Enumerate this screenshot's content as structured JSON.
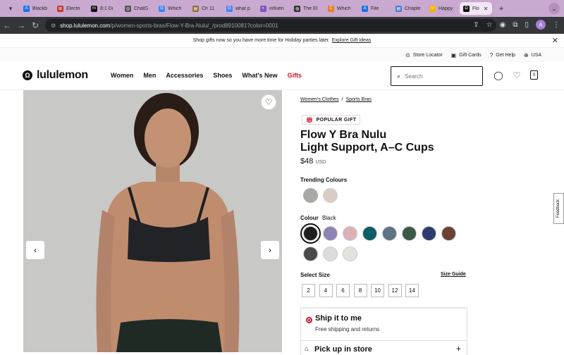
{
  "tabs": [
    {
      "label": "Blackb",
      "color": "#1a73e8",
      "glyph": "A"
    },
    {
      "label": "Electri",
      "color": "#c0392b",
      "glyph": "⊞"
    },
    {
      "label": "8:1 Di",
      "color": "#111111",
      "glyph": "m"
    },
    {
      "label": "ChatG",
      "color": "#555555",
      "glyph": "◎"
    },
    {
      "label": "Which",
      "color": "#4285f4",
      "glyph": "G"
    },
    {
      "label": "Ch 11",
      "color": "#8d6e3a",
      "glyph": "▤"
    },
    {
      "label": "what p",
      "color": "#4285f4",
      "glyph": "G"
    },
    {
      "label": "influen",
      "color": "#7e57c2",
      "glyph": "◐"
    },
    {
      "label": "The El",
      "color": "#333333",
      "glyph": "◍"
    },
    {
      "label": "Which",
      "color": "#e67e22",
      "glyph": "C"
    },
    {
      "label": "File",
      "color": "#1a73e8",
      "glyph": "A"
    },
    {
      "label": "Chapte",
      "color": "#4a7bd0",
      "glyph": "▤"
    },
    {
      "label": "Happy",
      "color": "#f5b400",
      "glyph": "☺"
    },
    {
      "label": "Flo",
      "color": "#111111",
      "glyph": "Ω"
    }
  ],
  "browser": {
    "url_host": "shop.lululemon.com",
    "url_path": "/p/women-sports-bras/Flow-Y-Bra-Nulu/_/prod8910081?color=0001",
    "profile_initial": "A"
  },
  "promo": {
    "text": "Shop gifts now so you have more time for Holiday parties later.",
    "link": "Explore Gift Ideas"
  },
  "utility": {
    "store_locator": "Store Locator",
    "gift_cards": "Gift Cards",
    "get_help": "Get Help",
    "region": "USA"
  },
  "header": {
    "logo_text": "lululemon",
    "menu": [
      "Women",
      "Men",
      "Accessories",
      "Shoes",
      "What's New",
      "Gifts"
    ],
    "search_placeholder": "Search",
    "bag_count": "0"
  },
  "product": {
    "breadcrumbs": [
      "Women's Clothes",
      "Sports Bras"
    ],
    "breadcrumb_sep": "/",
    "badge": "POPULAR GIFT",
    "title_line1": "Flow Y Bra Nulu",
    "title_line2": "Light Support, A–C Cups",
    "price": "$48",
    "currency": "USD",
    "trending_label": "Trending Colours",
    "trending_colors": [
      "#a9a9a8",
      "#d9ccc6"
    ],
    "colour_label": "Colour",
    "colour_value": "Black",
    "colors": [
      "#1d1d1d",
      "#8f82b4",
      "#dcb2b8",
      "#0b5e63",
      "#5f7482",
      "#3a5a47",
      "#2e3b6d",
      "#6a4235",
      "#4a4a4a",
      "#dcdcdc",
      "#e3e1dc"
    ],
    "size_label": "Select Size",
    "size_guide": "Size Guide",
    "sizes": [
      "2",
      "4",
      "6",
      "8",
      "10",
      "12",
      "14"
    ],
    "ship_title": "Ship it to me",
    "ship_sub": "Free shipping and returns",
    "pickup_title": "Pick up in store"
  },
  "feedback": "Feedback"
}
